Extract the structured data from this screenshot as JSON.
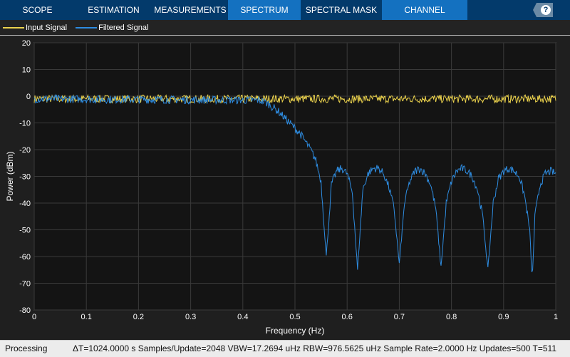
{
  "toolbar": {
    "tabs": [
      "SCOPE",
      "ESTIMATION",
      "MEASUREMENTS",
      "SPECTRUM",
      "SPECTRAL MASK",
      "CHANNEL MEASUREMENTS"
    ],
    "active": "SPECTRUM",
    "help": "?"
  },
  "legend": [
    {
      "label": "Input Signal",
      "color": "#ecd34d"
    },
    {
      "label": "Filtered Signal",
      "color": "#2e8ce0"
    }
  ],
  "status": {
    "state": "Processing",
    "info": "ΔT=1024.0000 s  Samples/Update=2048  VBW=17.2694 uHz  RBW=976.5625 uHz  Sample Rate=2.0000 Hz  Updates=500  T=511"
  },
  "chart_data": {
    "type": "line",
    "xlabel": "Frequency (Hz)",
    "ylabel": "Power (dBm)",
    "xlim": [
      0,
      1
    ],
    "ylim": [
      -80,
      20
    ],
    "grid": true,
    "xticks": [
      "0",
      "0.1",
      "0.2",
      "0.3",
      "0.4",
      "0.5",
      "0.6",
      "0.7",
      "0.8",
      "0.9",
      "1"
    ],
    "yticks": [
      "20",
      "10",
      "0",
      "-10",
      "-20",
      "-30",
      "-40",
      "-50",
      "-60",
      "-70",
      "-80"
    ],
    "series": [
      {
        "name": "Input Signal",
        "color": "#ecd34d",
        "x": [
          0,
          1
        ],
        "y": [
          -1,
          -1
        ]
      },
      {
        "name": "Filtered Signal",
        "color": "#2e8ce0",
        "x": [
          0,
          0.43,
          0.44,
          0.45,
          0.46,
          0.47,
          0.48,
          0.49,
          0.5,
          0.51,
          0.52,
          0.53,
          0.54,
          0.55,
          0.56,
          0.57,
          0.58,
          0.59,
          0.6,
          0.61,
          0.62,
          0.63,
          0.64,
          0.65,
          0.66,
          0.67,
          0.68,
          0.69,
          0.7,
          0.71,
          0.72,
          0.73,
          0.74,
          0.75,
          0.76,
          0.77,
          0.78,
          0.79,
          0.8,
          0.81,
          0.82,
          0.83,
          0.84,
          0.85,
          0.86,
          0.87,
          0.88,
          0.89,
          0.9,
          0.91,
          0.92,
          0.93,
          0.94,
          0.95,
          0.955,
          0.96,
          0.97,
          0.98,
          0.99,
          1
        ],
        "y": [
          -1,
          -1.5,
          -2,
          -3,
          -4.5,
          -6,
          -8,
          -10,
          -12,
          -14,
          -17,
          -20,
          -24,
          -32,
          -60,
          -33,
          -28,
          -27,
          -29,
          -36,
          -65,
          -35,
          -29,
          -27,
          -27,
          -29,
          -34,
          -42,
          -63,
          -40,
          -32,
          -28,
          -27,
          -29,
          -33,
          -42,
          -64,
          -40,
          -32,
          -28,
          -27,
          -28,
          -30,
          -35,
          -45,
          -65,
          -40,
          -31,
          -28,
          -27,
          -28,
          -30,
          -37,
          -50,
          -69,
          -45,
          -33,
          -29,
          -28,
          -29
        ]
      }
    ]
  }
}
